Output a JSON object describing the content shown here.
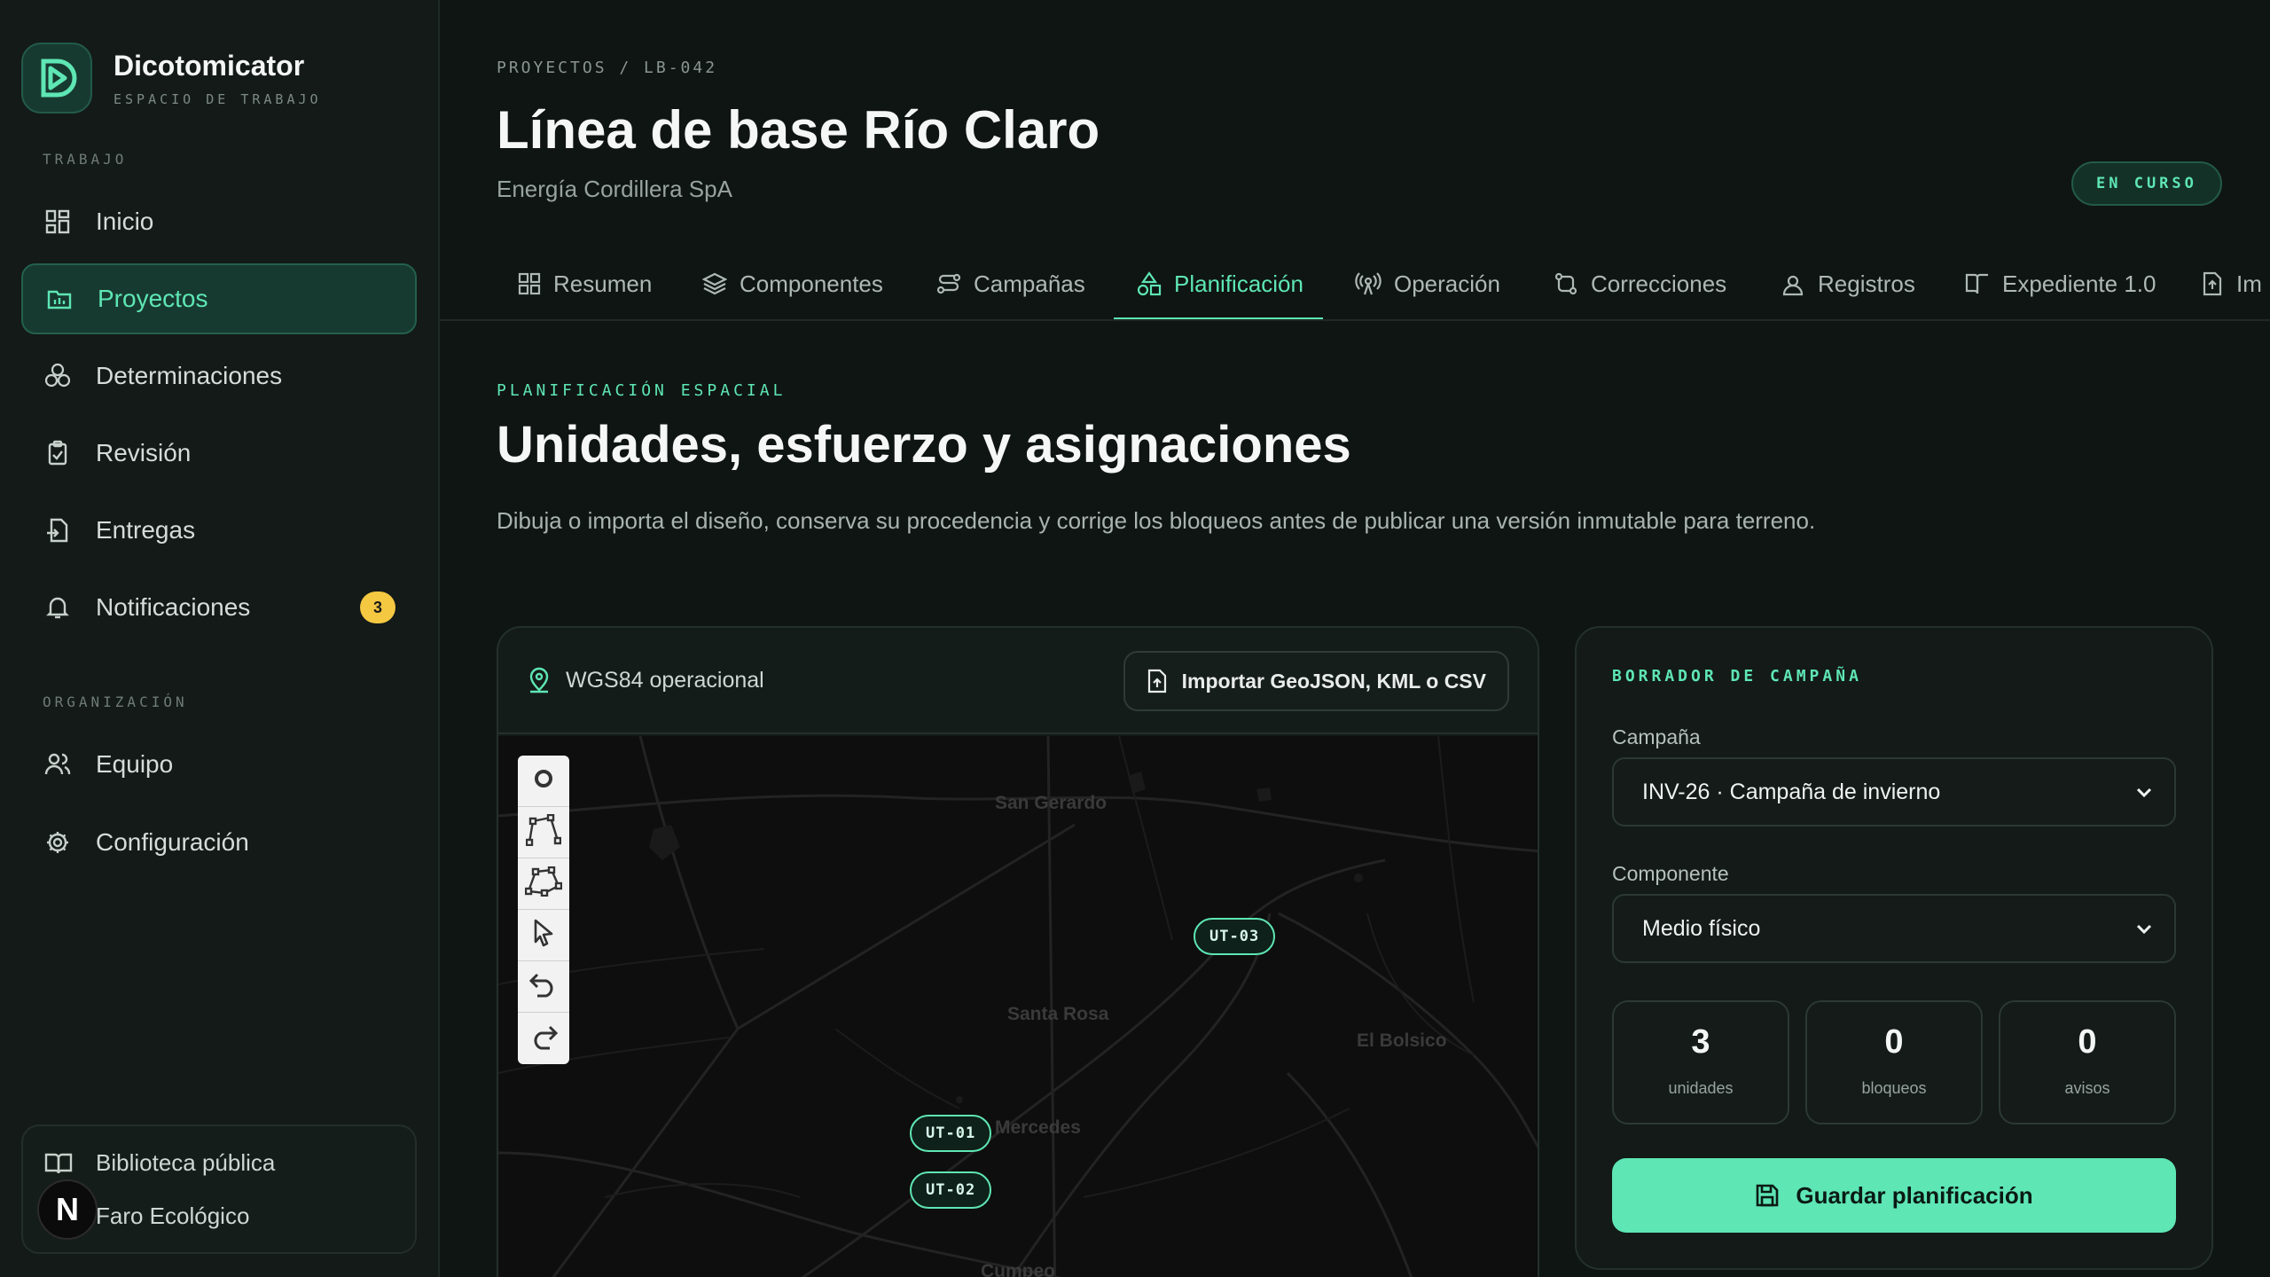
{
  "app": {
    "name": "Dicotomicator",
    "subtitle": "ESPACIO DE TRABAJO"
  },
  "sidebar": {
    "work_label": "TRABAJO",
    "org_label": "ORGANIZACIÓN",
    "items": [
      {
        "label": "Inicio",
        "icon": "grid-icon"
      },
      {
        "label": "Proyectos",
        "icon": "folder-chart-icon",
        "active": true
      },
      {
        "label": "Determinaciones",
        "icon": "flask-cluster-icon"
      },
      {
        "label": "Revisión",
        "icon": "clipboard-check-icon"
      },
      {
        "label": "Entregas",
        "icon": "file-export-icon"
      },
      {
        "label": "Notificaciones",
        "icon": "bell-icon",
        "badge": "3"
      }
    ],
    "org_items": [
      {
        "label": "Equipo",
        "icon": "users-icon"
      },
      {
        "label": "Configuración",
        "icon": "gear-icon"
      }
    ],
    "footer": {
      "library": "Biblioteca pública",
      "org_name": "Faro Ecológico",
      "avatar": "N"
    }
  },
  "header": {
    "breadcrumb": "PROYECTOS / LB-042",
    "title": "Línea de base Río Claro",
    "subtitle": "Energía Cordillera SpA",
    "status": "EN CURSO"
  },
  "tabs": [
    {
      "label": "Resumen",
      "icon": "grid-icon"
    },
    {
      "label": "Componentes",
      "icon": "layers-icon"
    },
    {
      "label": "Campañas",
      "icon": "route-icon"
    },
    {
      "label": "Planificación",
      "icon": "shapes-icon",
      "active": true
    },
    {
      "label": "Operación",
      "icon": "broadcast-icon"
    },
    {
      "label": "Correcciones",
      "icon": "git-compare-icon"
    },
    {
      "label": "Registros",
      "icon": "user-pin-icon"
    },
    {
      "label": "Expediente 1.0",
      "icon": "book-icon"
    },
    {
      "label": "Im",
      "icon": "file-import-icon"
    }
  ],
  "section": {
    "eyebrow": "PLANIFICACIÓN ESPACIAL",
    "title": "Unidades, esfuerzo y asignaciones",
    "description": "Dibuja o importa el diseño, conserva su procedencia y corrige los bloqueos antes de publicar una versión inmutable para terreno."
  },
  "map": {
    "crs": "WGS84 operacional",
    "import_label": "Importar GeoJSON, KML o CSV",
    "places": [
      "San Gerardo",
      "Santa Rosa",
      "El Bolsico",
      "Mercedes",
      "Cumpeo"
    ],
    "units": [
      "UT-03",
      "UT-01",
      "UT-02"
    ],
    "tools": [
      "circle-marker-icon",
      "polyline-icon",
      "polygon-icon",
      "select-pointer-icon",
      "undo-icon",
      "redo-icon"
    ]
  },
  "panel": {
    "eyebrow": "BORRADOR DE CAMPAÑA",
    "campaign_label": "Campaña",
    "campaign_value": "INV-26 · Campaña de invierno",
    "component_label": "Componente",
    "component_value": "Medio físico",
    "stats": [
      {
        "value": "3",
        "label": "unidades"
      },
      {
        "value": "0",
        "label": "bloqueos"
      },
      {
        "value": "0",
        "label": "avisos"
      }
    ],
    "save_label": "Guardar planificación"
  },
  "colors": {
    "accent": "#5ee6b4",
    "background": "#0f1513",
    "badge": "#f5c842"
  }
}
